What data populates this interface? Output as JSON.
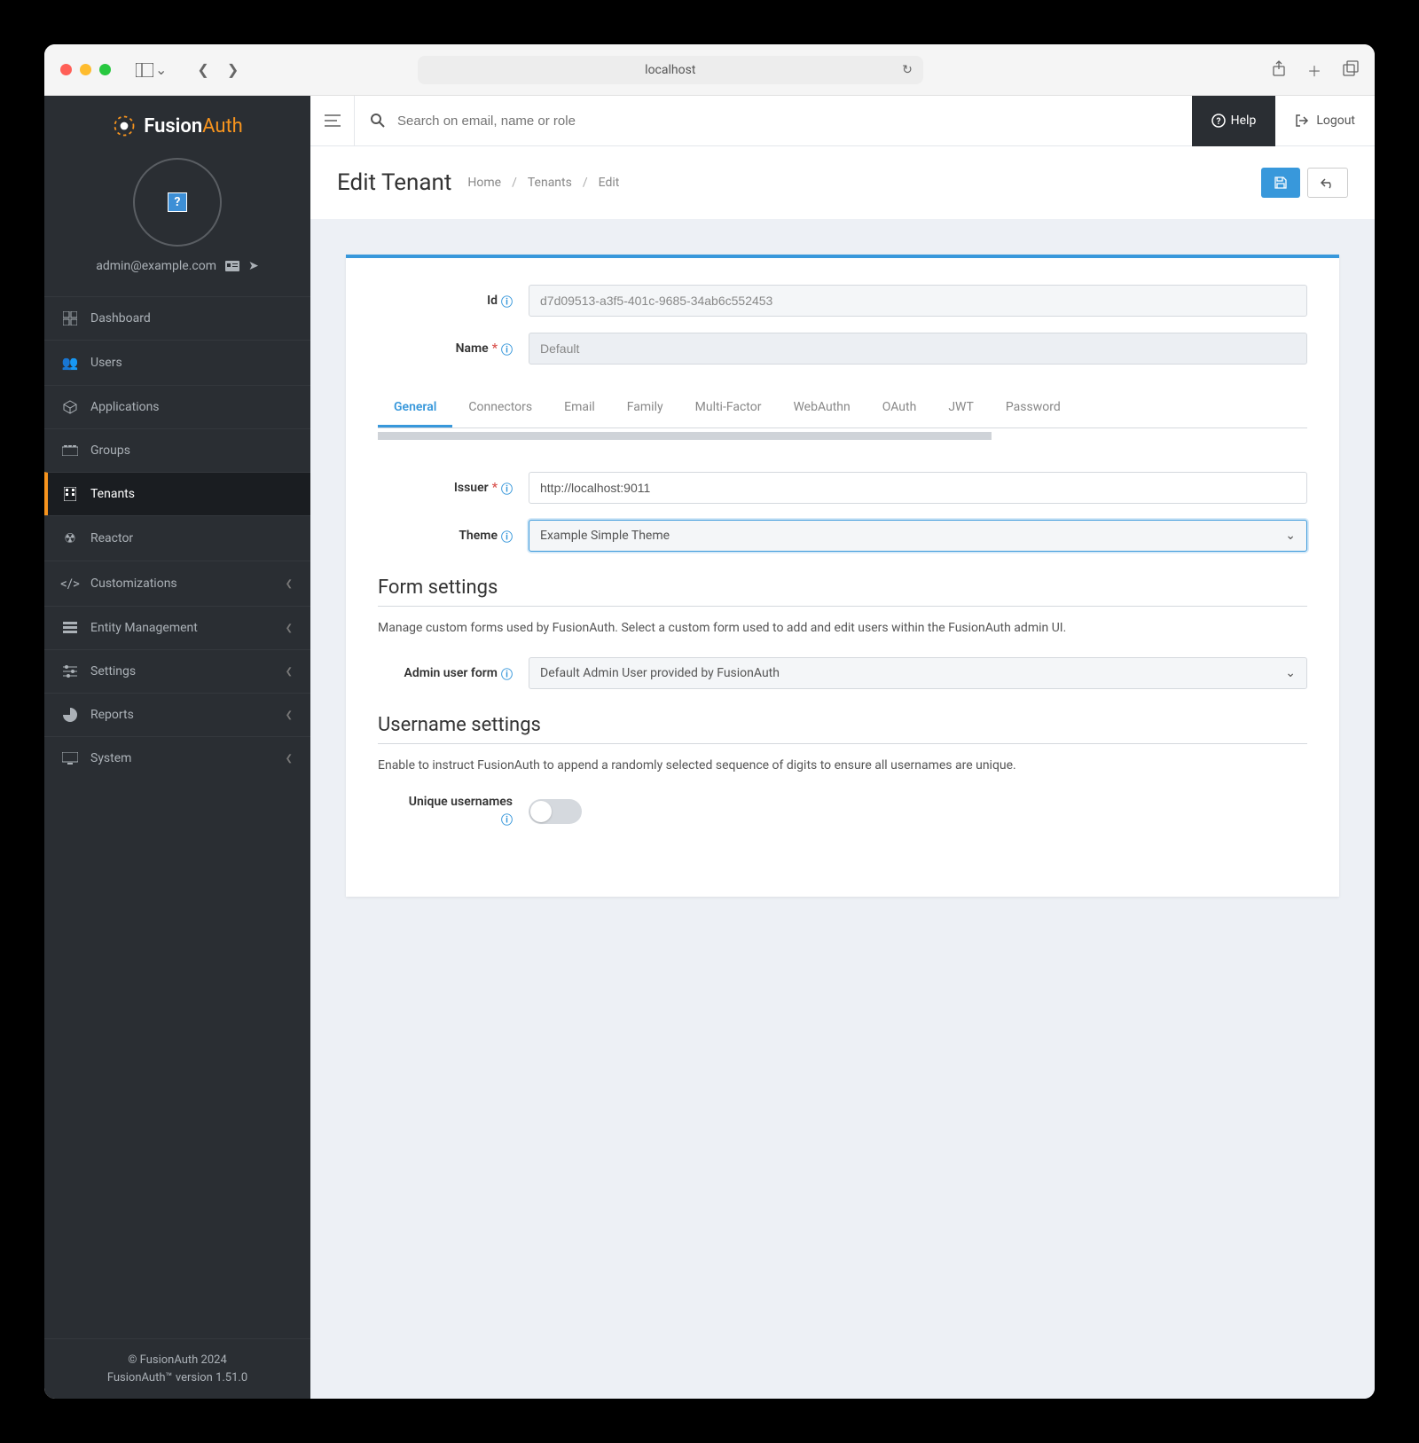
{
  "browser": {
    "address": "localhost"
  },
  "brand": {
    "name_main": "Fusion",
    "name_accent": "Auth"
  },
  "user": {
    "email": "admin@example.com"
  },
  "sidebar": {
    "items": [
      {
        "label": "Dashboard",
        "icon": "dashboard"
      },
      {
        "label": "Users",
        "icon": "users"
      },
      {
        "label": "Applications",
        "icon": "applications"
      },
      {
        "label": "Groups",
        "icon": "groups"
      },
      {
        "label": "Tenants",
        "icon": "tenants"
      },
      {
        "label": "Reactor",
        "icon": "reactor"
      },
      {
        "label": "Customizations",
        "icon": "customizations"
      },
      {
        "label": "Entity Management",
        "icon": "entity"
      },
      {
        "label": "Settings",
        "icon": "settings"
      },
      {
        "label": "Reports",
        "icon": "reports"
      },
      {
        "label": "System",
        "icon": "system"
      }
    ]
  },
  "footer": {
    "copyright": "© FusionAuth 2024",
    "version": "FusionAuth™ version 1.51.0"
  },
  "topbar": {
    "search_placeholder": "Search on email, name or role",
    "help": "Help",
    "logout": "Logout"
  },
  "page": {
    "title": "Edit Tenant",
    "breadcrumbs": [
      "Home",
      "Tenants",
      "Edit"
    ]
  },
  "form": {
    "id_label": "Id",
    "id_value": "d7d09513-a3f5-401c-9685-34ab6c552453",
    "name_label": "Name",
    "name_value": "Default",
    "tabs": [
      "General",
      "Connectors",
      "Email",
      "Family",
      "Multi-Factor",
      "WebAuthn",
      "OAuth",
      "JWT",
      "Password"
    ],
    "issuer_label": "Issuer",
    "issuer_value": "http://localhost:9011",
    "theme_label": "Theme",
    "theme_value": "Example Simple Theme",
    "form_settings": {
      "title": "Form settings",
      "description": "Manage custom forms used by FusionAuth. Select a custom form used to add and edit users within the FusionAuth admin UI.",
      "admin_form_label": "Admin user form",
      "admin_form_value": "Default Admin User provided by FusionAuth"
    },
    "username_settings": {
      "title": "Username settings",
      "description": "Enable to instruct FusionAuth to append a randomly selected sequence of digits to ensure all usernames are unique.",
      "unique_label": "Unique usernames",
      "unique_value": false
    }
  }
}
